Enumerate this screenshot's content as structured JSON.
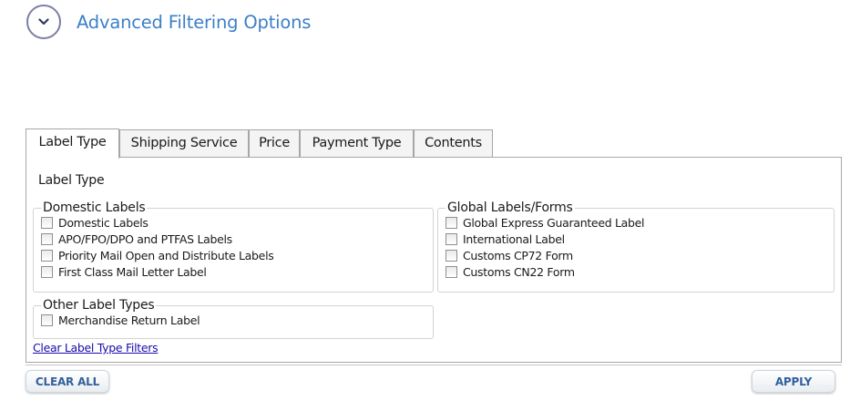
{
  "header": {
    "title": "Advanced Filtering Options",
    "toggle_icon": "chevron-down-icon"
  },
  "tabs": [
    {
      "label": "Label Type",
      "active": true
    },
    {
      "label": "Shipping Service",
      "active": false
    },
    {
      "label": "Price",
      "active": false
    },
    {
      "label": "Payment Type",
      "active": false
    },
    {
      "label": "Contents",
      "active": false
    }
  ],
  "panel": {
    "heading": "Label Type",
    "domestic": {
      "legend": "Domestic Labels",
      "items": [
        {
          "label": "Domestic Labels",
          "checked": false
        },
        {
          "label": "APO/FPO/DPO and PTFAS Labels",
          "checked": false
        },
        {
          "label": "Priority Mail Open and Distribute Labels",
          "checked": false
        },
        {
          "label": "First Class Mail Letter Label",
          "checked": false
        }
      ]
    },
    "global": {
      "legend": "Global Labels/Forms",
      "items": [
        {
          "label": "Global Express Guaranteed Label",
          "checked": false
        },
        {
          "label": "International Label",
          "checked": false
        },
        {
          "label": "Customs CP72 Form",
          "checked": false
        },
        {
          "label": "Customs CN22 Form",
          "checked": false
        }
      ]
    },
    "other": {
      "legend": "Other Label Types",
      "items": [
        {
          "label": "Merchandise Return Label",
          "checked": false
        }
      ]
    },
    "clear_link": "Clear Label Type Filters"
  },
  "footer": {
    "clear_all": "CLEAR ALL",
    "apply": "APPLY"
  },
  "colors": {
    "title": "#3d7fc6",
    "button_text": "#33619b",
    "link": "#1a0dab",
    "toggle_border": "#7d7fa3"
  }
}
